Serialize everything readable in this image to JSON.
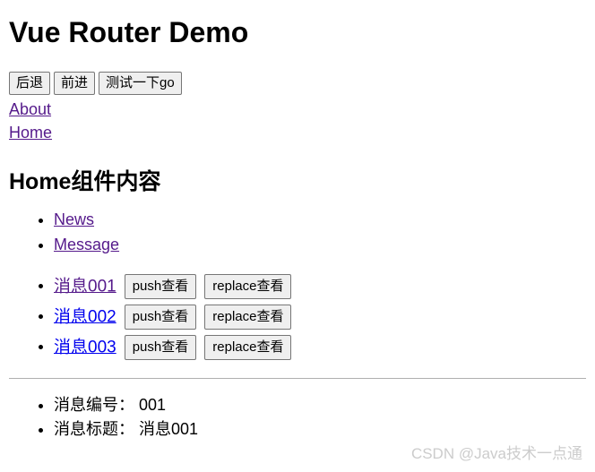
{
  "page": {
    "title": "Vue Router Demo",
    "section_heading": "Home组件内容"
  },
  "history_controls": {
    "back_label": "后退",
    "forward_label": "前进",
    "go_label": "测试一下go"
  },
  "top_nav": {
    "links": [
      {
        "label": "About",
        "state": "visited"
      },
      {
        "label": "Home",
        "state": "visited"
      }
    ]
  },
  "home_nav": {
    "links": [
      {
        "label": "News",
        "state": "visited"
      },
      {
        "label": "Message",
        "state": "visited"
      }
    ]
  },
  "messages": {
    "push_label": "push查看",
    "replace_label": "replace查看",
    "items": [
      {
        "label": "消息001",
        "state": "visited"
      },
      {
        "label": "消息002",
        "state": "unvisited"
      },
      {
        "label": "消息003",
        "state": "unvisited"
      }
    ]
  },
  "detail": {
    "rows": [
      "消息编号： 001",
      "消息标题： 消息001"
    ]
  },
  "watermark": {
    "text": "CSDN @Java技术一点通",
    "color": "#cccccc"
  }
}
